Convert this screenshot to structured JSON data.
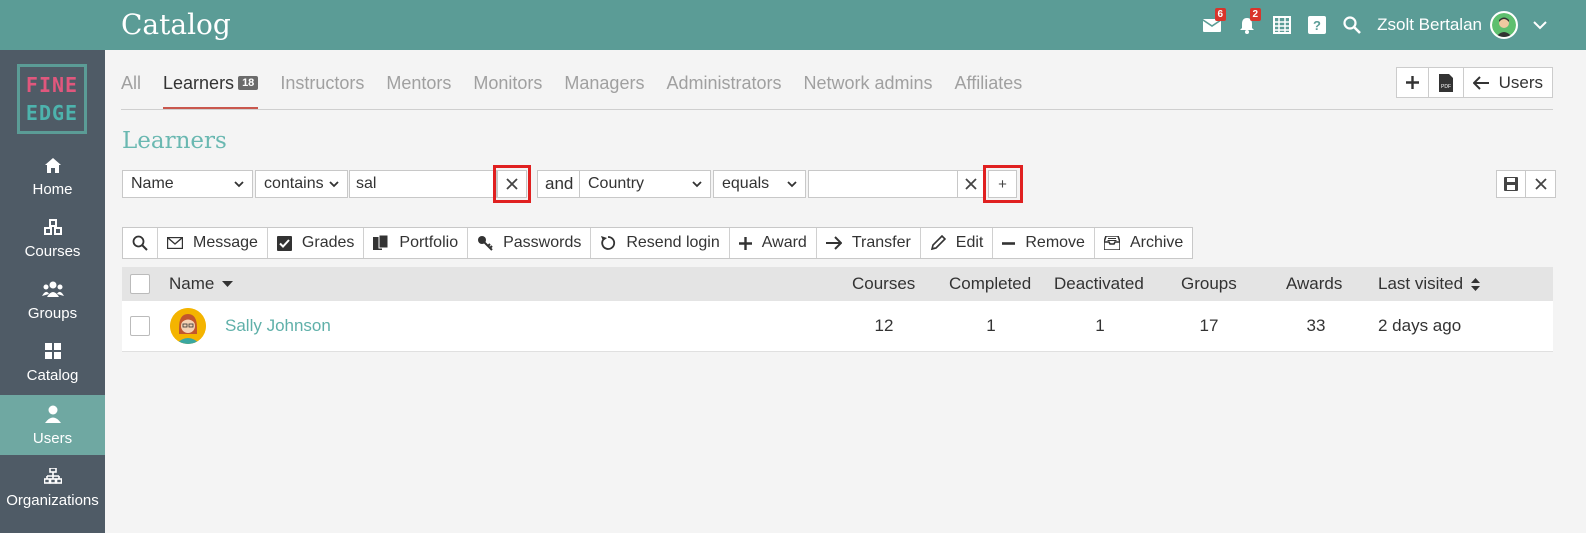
{
  "header": {
    "title": "Catalog",
    "messages_badge": "6",
    "notifications_badge": "2",
    "user_name": "Zsolt Bertalan"
  },
  "sidebar": {
    "logo_line1": "FINE",
    "logo_line2": "EDGE",
    "items": [
      {
        "label": "Home",
        "icon": "home-icon"
      },
      {
        "label": "Courses",
        "icon": "courses-icon"
      },
      {
        "label": "Groups",
        "icon": "groups-icon"
      },
      {
        "label": "Catalog",
        "icon": "catalog-icon"
      },
      {
        "label": "Users",
        "icon": "user-icon",
        "active": true
      },
      {
        "label": "Organizations",
        "icon": "organizations-icon"
      }
    ]
  },
  "tabs": [
    {
      "label": "All"
    },
    {
      "label": "Learners",
      "count": "18",
      "active": true
    },
    {
      "label": "Instructors"
    },
    {
      "label": "Mentors"
    },
    {
      "label": "Monitors"
    },
    {
      "label": "Managers"
    },
    {
      "label": "Administrators"
    },
    {
      "label": "Network admins"
    },
    {
      "label": "Affiliates"
    }
  ],
  "top_buttons": {
    "add": "+",
    "pdf": "PDF",
    "users": "Users"
  },
  "section_title": "Learners",
  "filter": {
    "field1": "Name",
    "op1": "contains",
    "value1": "sal",
    "joiner": "and",
    "field2": "Country",
    "op2": "equals",
    "value2": "",
    "add_label": "+"
  },
  "toolbar": {
    "message": "Message",
    "grades": "Grades",
    "portfolio": "Portfolio",
    "passwords": "Passwords",
    "resend": "Resend login",
    "award": "Award",
    "transfer": "Transfer",
    "edit": "Edit",
    "remove": "Remove",
    "archive": "Archive"
  },
  "table": {
    "headers": {
      "name": "Name",
      "courses": "Courses",
      "completed": "Completed",
      "deactivated": "Deactivated",
      "groups": "Groups",
      "awards": "Awards",
      "last_visited": "Last visited"
    },
    "rows": [
      {
        "name": "Sally Johnson",
        "courses": "12",
        "completed": "1",
        "deactivated": "1",
        "groups": "17",
        "awards": "33",
        "last_visited": "2 days ago"
      }
    ]
  },
  "colors": {
    "topbar": "#5b9c96",
    "sidebar": "#4f5b66",
    "accent": "#6ab8b1",
    "highlight": "#e02020"
  }
}
